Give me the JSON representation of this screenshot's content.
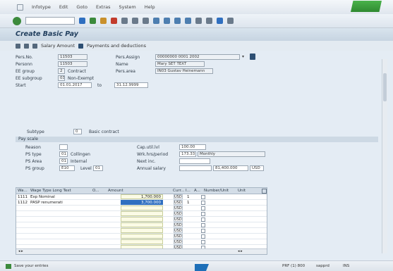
{
  "menu": {
    "items": [
      "Infotype",
      "Edit",
      "Goto",
      "Extras",
      "System",
      "Help"
    ]
  },
  "command_field": {
    "value": ""
  },
  "title": "Create Basic Pay",
  "app_toolbar": {
    "salary_amount": "Salary Amount",
    "payments": "Payments and deductions"
  },
  "header": {
    "pers_no": {
      "label": "Pers.No.",
      "value": "11503"
    },
    "pers_assign": {
      "label": "Pers.Assign",
      "value": "00000000 0001 2002"
    },
    "personn": {
      "label": "Personn",
      "value": "11503"
    },
    "name": {
      "label": "Name",
      "value": "Mary SET TEXT"
    },
    "ee_group": {
      "label": "EE group",
      "value": "2",
      "text": "Contract"
    },
    "pers_area": {
      "label": "Pers.area",
      "value": "IN03 Gustav Heinemann"
    },
    "ee_subgroup": {
      "label": "EE subgroup",
      "value": "03",
      "text": "Non-Exempt"
    },
    "start": {
      "label": "Start",
      "value": "01.01.2017",
      "to": "to",
      "end": "31.12.9999"
    }
  },
  "reason": {
    "label": "Subtype",
    "value": "0",
    "text": "Basic contract"
  },
  "pay_scale": {
    "title": "Pay scale",
    "reason": {
      "label": "Reason",
      "value": ""
    },
    "ps_type": {
      "label": "PS type",
      "value": "01",
      "text": "Collingen"
    },
    "ps_area": {
      "label": "PS Area",
      "value": "01",
      "text": "Internal"
    },
    "ps_group": {
      "label": "PS group",
      "value": "E10",
      "level_label": "Level",
      "level": "01"
    },
    "cap_util_lvl": {
      "label": "Cap.util.lvl",
      "value": "100.00"
    },
    "work_hrs": {
      "label": "Wrk.hrs/period",
      "value": "173.33",
      "text": "Monthly"
    },
    "next_inc": {
      "label": "Next inc.",
      "value": ""
    },
    "annual_salary": {
      "label": "Annual salary",
      "value": "81,400.000",
      "currency": "USD"
    }
  },
  "wage_table": {
    "columns": [
      "Wa...",
      "Wage Type Long Text",
      "O...",
      "Amount",
      "Curr...",
      "I...",
      "A...",
      "Number/Unit",
      "Unit"
    ],
    "rows": [
      {
        "code": "1111",
        "text": "Exp Nominal",
        "op": "",
        "amount": "1,700.000",
        "curr": "USD",
        "i": "1",
        "selected": false
      },
      {
        "code": "1112",
        "text": "PASP renumerati",
        "op": "",
        "amount": "3,700.000",
        "curr": "USD",
        "i": "1",
        "selected": true
      },
      {
        "code": "",
        "text": "",
        "op": "",
        "amount": "",
        "curr": "USD",
        "i": "",
        "selected": false
      },
      {
        "code": "",
        "text": "",
        "op": "",
        "amount": "",
        "curr": "USD",
        "i": "",
        "selected": false
      },
      {
        "code": "",
        "text": "",
        "op": "",
        "amount": "",
        "curr": "USD",
        "i": "",
        "selected": false
      },
      {
        "code": "",
        "text": "",
        "op": "",
        "amount": "",
        "curr": "USD",
        "i": "",
        "selected": false
      },
      {
        "code": "",
        "text": "",
        "op": "",
        "amount": "",
        "curr": "USD",
        "i": "",
        "selected": false
      },
      {
        "code": "",
        "text": "",
        "op": "",
        "amount": "",
        "curr": "USD",
        "i": "",
        "selected": false
      },
      {
        "code": "",
        "text": "",
        "op": "",
        "amount": "",
        "curr": "USD",
        "i": "",
        "selected": false
      },
      {
        "code": "",
        "text": "",
        "op": "",
        "amount": "",
        "curr": "USD",
        "i": "",
        "selected": false
      }
    ]
  },
  "status": {
    "message": "Save your entries",
    "system": "PRF (1) 800",
    "server": "sapprd",
    "mode": "INS"
  },
  "colors": {
    "title": "#23405f",
    "selection": "#2f6fc0",
    "highlight": "#f7e37a",
    "sap_green": "#49b24a"
  }
}
